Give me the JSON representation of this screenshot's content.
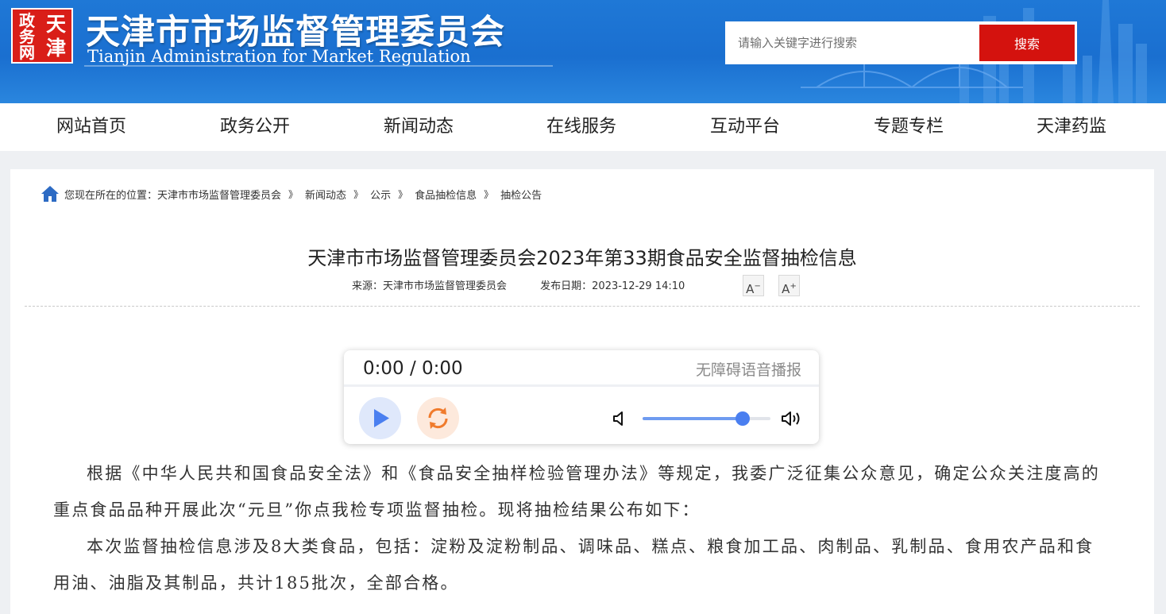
{
  "header": {
    "seal_chars": [
      "天",
      "津",
      "政",
      "务",
      "网"
    ],
    "title_cn": "天津市市场监督管理委员会",
    "title_en": "Tianjin Administration for Market Regulation",
    "search_placeholder": "请输入关键字进行搜索",
    "search_button": "搜索"
  },
  "nav": {
    "items": [
      "网站首页",
      "政务公开",
      "新闻动态",
      "在线服务",
      "互动平台",
      "专题专栏",
      "天津药监"
    ]
  },
  "breadcrumb": {
    "prefix": "您现在所在的位置：",
    "items": [
      "天津市市场监督管理委员会",
      "新闻动态",
      "公示",
      "食品抽检信息",
      "抽检公告"
    ],
    "separator": "》"
  },
  "article": {
    "title": "天津市市场监督管理委员会2023年第33期食品安全监督抽检信息",
    "source": "来源：天津市市场监督管理委员会",
    "date": "发布日期：2023-12-29 14:10",
    "font_decrease": "A",
    "font_increase": "A",
    "paragraphs": [
      "根据《中华人民共和国食品安全法》和《食品安全抽样检验管理办法》等规定，我委广泛征集公众意见，确定公众关注度高的重点食品品种开展此次“元旦”你点我检专项监督抽检。现将抽检结果公布如下：",
      "本次监督抽检信息涉及8大类食品，包括：淀粉及淀粉制品、调味品、糕点、粮食加工品、肉制品、乳制品、食用农产品和食用油、油脂及其制品，共计185批次，全部合格。"
    ]
  },
  "player": {
    "time": "0:00 / 0:00",
    "label": "无障碍语音播报",
    "volume": 0.78
  },
  "colors": {
    "header_blue": "#1f78d6",
    "search_red": "#d4120e",
    "seal_red": "#d91e18",
    "play_blue": "#4a7ff0",
    "loop_orange": "#f07b2c"
  }
}
